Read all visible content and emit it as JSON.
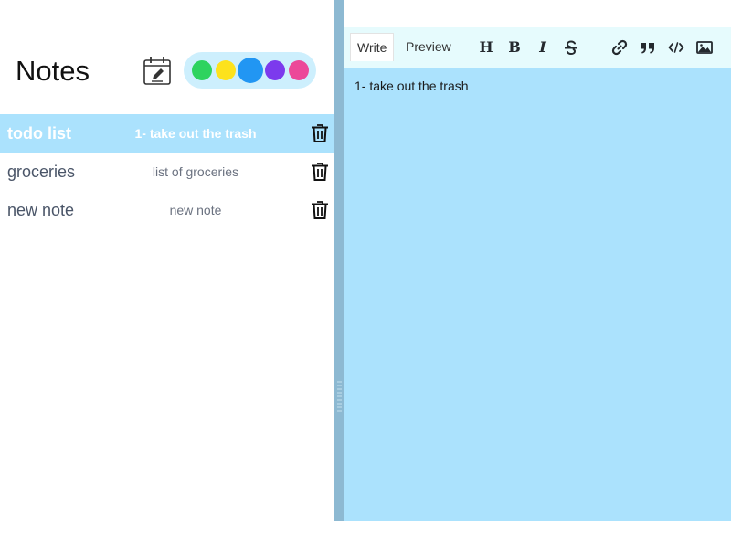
{
  "app": {
    "title": "Notes"
  },
  "colors": {
    "swatches": [
      {
        "name": "green",
        "hex": "#2ed35f"
      },
      {
        "name": "yellow",
        "hex": "#fde21d"
      },
      {
        "name": "blue",
        "hex": "#2196f3",
        "selected": true
      },
      {
        "name": "purple",
        "hex": "#7c3aed"
      },
      {
        "name": "pink",
        "hex": "#ec4899"
      }
    ]
  },
  "notes": [
    {
      "title": "todo list",
      "preview": "1- take out the trash",
      "active": true
    },
    {
      "title": "groceries",
      "preview": "list of groceries",
      "active": false
    },
    {
      "title": "new note",
      "preview": "new note",
      "active": false
    }
  ],
  "editor": {
    "tabs": {
      "write": "Write",
      "preview": "Preview"
    },
    "active_tab": "write",
    "toolbar": {
      "header": "H",
      "bold": "B",
      "italic": "I"
    },
    "content": "1- take out the trash"
  }
}
